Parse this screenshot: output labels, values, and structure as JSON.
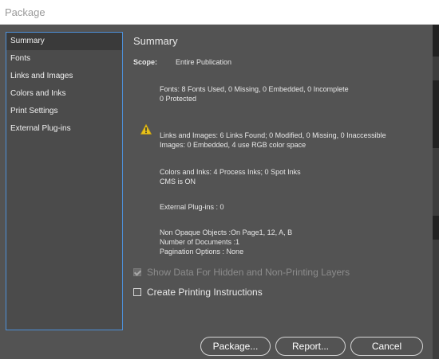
{
  "window": {
    "title": "Package"
  },
  "sidebar": {
    "items": [
      {
        "label": "Summary",
        "selected": true
      },
      {
        "label": "Fonts"
      },
      {
        "label": "Links and Images"
      },
      {
        "label": "Colors and Inks"
      },
      {
        "label": "Print Settings"
      },
      {
        "label": "External Plug-ins"
      }
    ]
  },
  "summary": {
    "title": "Summary",
    "scope_label": "Scope:",
    "scope_value": "Entire Publication",
    "fonts": [
      "Fonts: 8 Fonts Used, 0 Missing, 0 Embedded, 0 Incomplete",
      "0 Protected"
    ],
    "links": [
      "Links and Images: 6 Links Found; 0 Modified, 0 Missing, 0 Inaccessible",
      "Images: 0 Embedded, 4 use RGB color space"
    ],
    "colors": [
      "Colors and Inks: 4 Process Inks; 0 Spot Inks",
      "CMS is ON"
    ],
    "plugins": [
      "External Plug-ins : 0"
    ],
    "misc": [
      "Non Opaque Objects :On Page1, 12, A, B",
      "Number of Documents :1",
      "Pagination Options : None"
    ],
    "warning_icon": "warning-triangle-icon",
    "warning_color": "#e8c21a"
  },
  "options": {
    "show_hidden": {
      "label": "Show Data For Hidden and Non-Printing Layers",
      "checked": true,
      "disabled": true
    },
    "create_instructions": {
      "label": "Create Printing Instructions",
      "checked": false
    }
  },
  "buttons": {
    "package": "Package...",
    "report": "Report...",
    "cancel": "Cancel"
  },
  "colors": {
    "dialog_bg": "#535353",
    "selection_border": "#4d90d9"
  }
}
